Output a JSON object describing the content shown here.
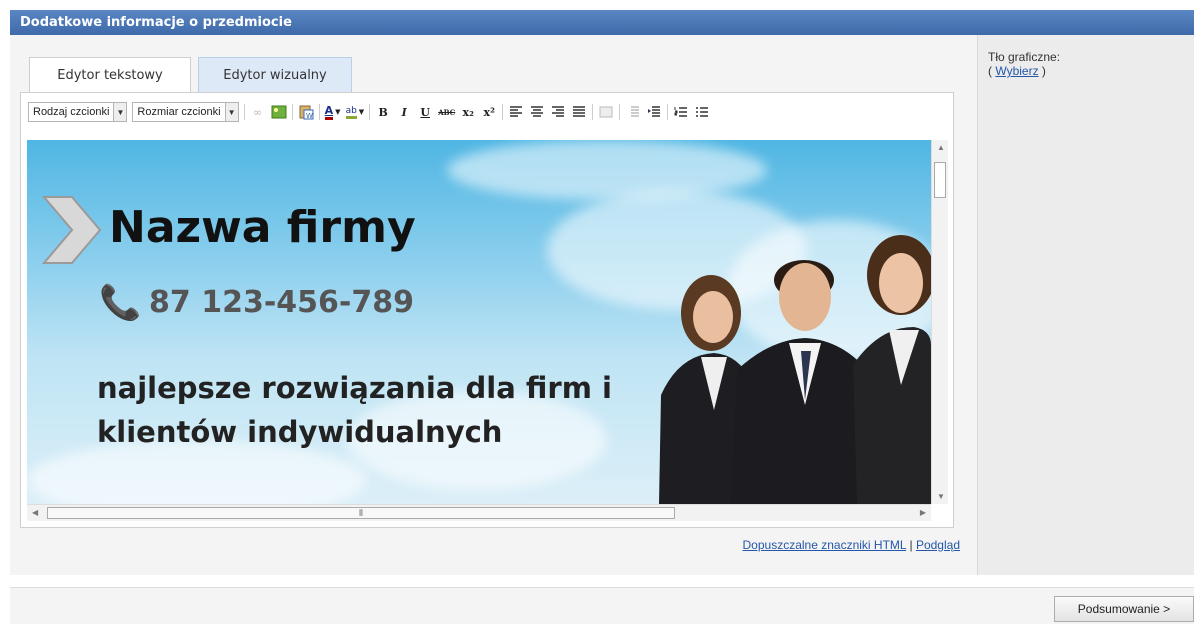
{
  "header": {
    "title": "Dodatkowe informacje o przedmiocie"
  },
  "tabs": [
    {
      "label": "Edytor tekstowy"
    },
    {
      "label": "Edytor wizualny"
    }
  ],
  "toolbar": {
    "font_family_label": "Rodzaj czcionki",
    "font_size_label": "Rozmiar czcionki",
    "buttons": {
      "bold": "B",
      "italic": "I",
      "underline": "U",
      "strike": "ABC",
      "sub": "x₂",
      "sup": "x²",
      "font_color": "A",
      "highlight": "ab"
    }
  },
  "banner": {
    "company": "Nazwa firmy",
    "phone": "87 123-456-789",
    "slogan_line1": "najlepsze rozwiązania dla firm i",
    "slogan_line2": "klientów indywidualnych"
  },
  "footer_links": {
    "allowed_html": "Dopuszczalne znaczniki HTML",
    "separator": "|",
    "preview": "Podgląd"
  },
  "background": {
    "label": "Tło graficzne:",
    "open": "(",
    "choose": "Wybierz",
    "close": ")"
  },
  "next_button": {
    "label": "Podsumowanie >"
  }
}
